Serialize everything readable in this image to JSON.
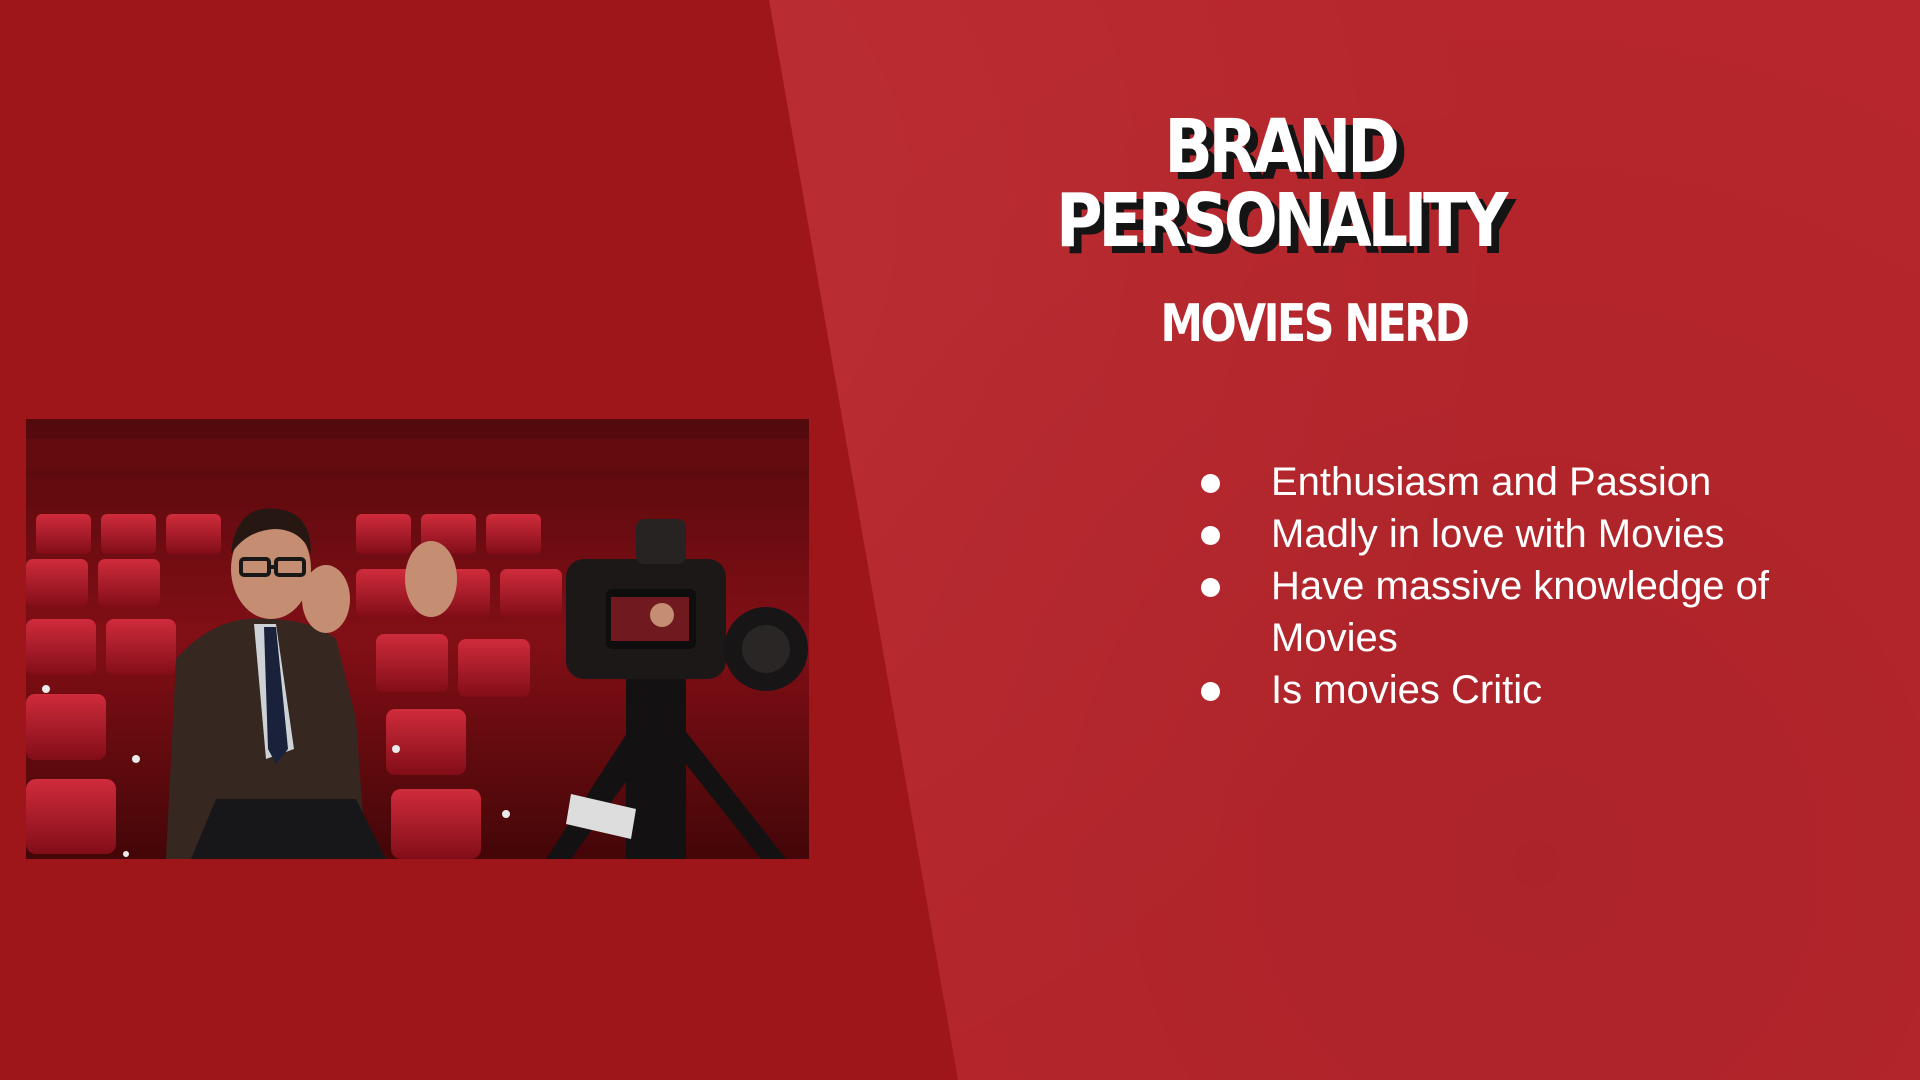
{
  "slide": {
    "title": "BRAND PERSONALITY",
    "subtitle": "MOVIES NERD",
    "bullets": [
      "Enthusiasm and Passion",
      "Madly in love with Movies",
      "Have massive knowledge of Movies",
      "Is movies Critic"
    ],
    "photo_icon": "interview-photo-icon"
  },
  "colors": {
    "left_background": "#9e161a",
    "right_background": "#b7262c",
    "text": "#ffffff",
    "title_shadow": "#141414"
  }
}
